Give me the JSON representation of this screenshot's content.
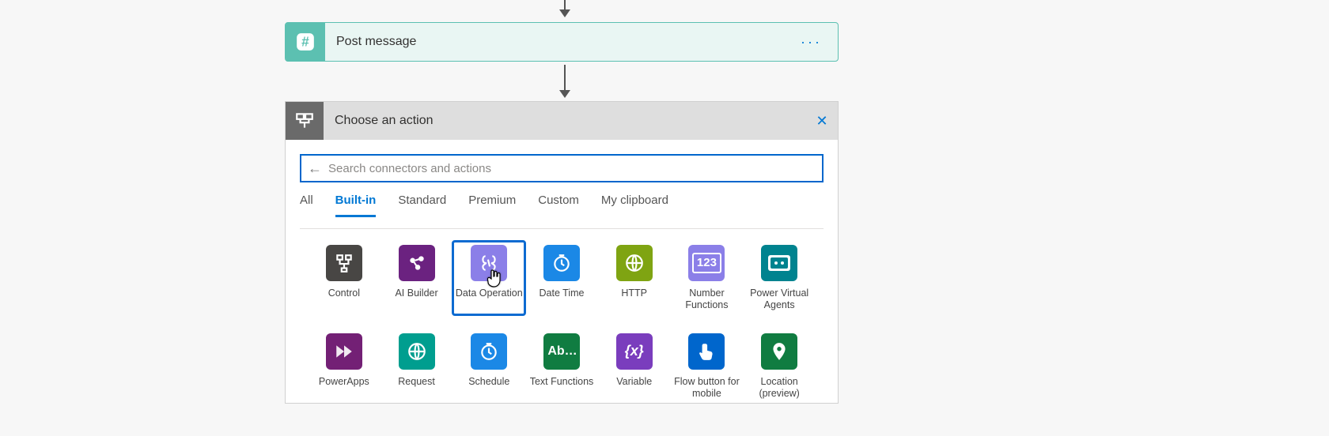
{
  "step": {
    "title": "Post message",
    "icon_name": "hash-icon"
  },
  "panel": {
    "title": "Choose an action",
    "search_placeholder": "Search connectors and actions"
  },
  "tabs": [
    {
      "label": "All",
      "active": false
    },
    {
      "label": "Built-in",
      "active": true
    },
    {
      "label": "Standard",
      "active": false
    },
    {
      "label": "Premium",
      "active": false
    },
    {
      "label": "Custom",
      "active": false
    },
    {
      "label": "My clipboard",
      "active": false
    }
  ],
  "connectors": [
    {
      "label": "Control",
      "color": "#484644",
      "glyph": "ctrl",
      "selected": false,
      "name": "control"
    },
    {
      "label": "AI Builder",
      "color": "#6b2280",
      "glyph": "ai",
      "selected": false,
      "name": "ai-builder"
    },
    {
      "label": "Data Operation",
      "color": "#8b7fe8",
      "glyph": "data",
      "selected": true,
      "name": "data-operation"
    },
    {
      "label": "Date Time",
      "color": "#1b88e6",
      "glyph": "clock",
      "selected": false,
      "name": "date-time"
    },
    {
      "label": "HTTP",
      "color": "#7fa412",
      "glyph": "http",
      "selected": false,
      "name": "http"
    },
    {
      "label": "Number Functions",
      "color": "#8b7fe8",
      "glyph": "123",
      "selected": false,
      "name": "number-functions"
    },
    {
      "label": "Power Virtual Agents",
      "color": "#00838f",
      "glyph": "pva",
      "selected": false,
      "name": "power-virtual-agents"
    },
    {
      "label": "PowerApps",
      "color": "#732075",
      "glyph": "pa",
      "selected": false,
      "name": "powerapps"
    },
    {
      "label": "Request",
      "color": "#009e8f",
      "glyph": "req",
      "selected": false,
      "name": "request"
    },
    {
      "label": "Schedule",
      "color": "#1b88e6",
      "glyph": "clock",
      "selected": false,
      "name": "schedule"
    },
    {
      "label": "Text Functions",
      "color": "#107c41",
      "glyph": "Ab",
      "selected": false,
      "name": "text-functions"
    },
    {
      "label": "Variable",
      "color": "#7a3dbd",
      "glyph": "{x}",
      "selected": false,
      "name": "variable"
    },
    {
      "label": "Flow button for mobile",
      "color": "#0066cc",
      "glyph": "tap",
      "selected": false,
      "name": "flow-button-for-mobile"
    },
    {
      "label": "Location (preview)",
      "color": "#107c41",
      "glyph": "pin",
      "selected": false,
      "name": "location-preview"
    }
  ]
}
